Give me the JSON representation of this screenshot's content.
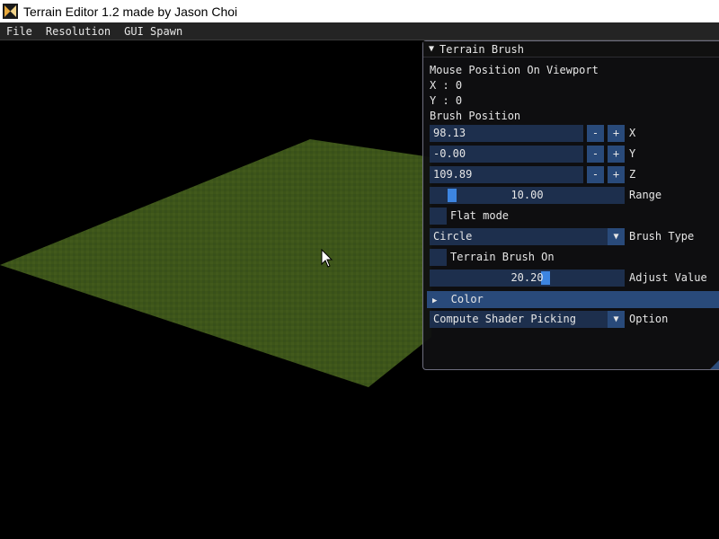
{
  "window": {
    "title": "Terrain Editor 1.2 made by Jason Choi"
  },
  "menu": {
    "items": [
      "File",
      "Resolution",
      "GUI Spawn"
    ]
  },
  "panel": {
    "title": "Terrain Brush",
    "mouse_position_label": "Mouse Position On Viewport",
    "mouse_x": "X : 0",
    "mouse_y": "Y : 0",
    "brush_position_label": "Brush Position",
    "brush_x": "98.13",
    "brush_y": "-0.00",
    "brush_z": "109.89",
    "axis_x": "X",
    "axis_y": "Y",
    "axis_z": "Z",
    "minus": "-",
    "plus": "+",
    "range_value": "10.00",
    "range_label": "Range",
    "flat_mode_label": "Flat mode",
    "brush_type_value": "Circle",
    "brush_type_label": "Brush Type",
    "terrain_brush_on_label": "Terrain Brush On",
    "adjust_value": "20.20",
    "adjust_label": "Adjust Value",
    "color_label": "Color",
    "option_value": "Compute Shader Picking",
    "option_label": "Option"
  },
  "colors": {
    "terrain": "#3d5519",
    "frame_bg": "#1d2f4d",
    "button": "#294a7a",
    "slider_grab": "#3d85e0"
  }
}
